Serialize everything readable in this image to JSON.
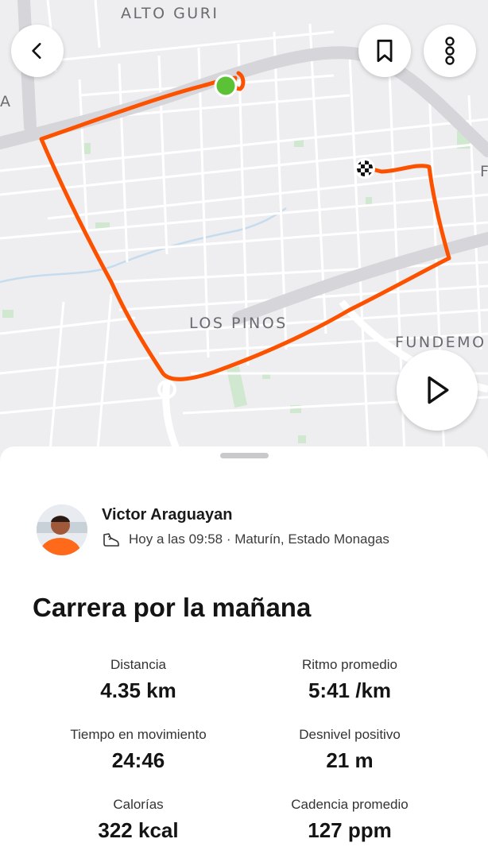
{
  "map": {
    "labels": [
      "ALTO GURI",
      "LOS PINOS",
      "FUNDEMO",
      "A",
      "F"
    ],
    "route_color": "#fc5200",
    "start_color": "#5bc236"
  },
  "controls": {
    "back_icon": "chevron-left-icon",
    "bookmark_icon": "bookmark-icon",
    "more_icon": "more-vertical-icon",
    "play_icon": "play-icon"
  },
  "activity": {
    "athlete_name": "Victor Araguayan",
    "meta_text": "Hoy a las 09:58 · Maturín, Estado Monagas",
    "title": "Carrera por la mañana"
  },
  "stats": [
    {
      "label": "Distancia",
      "value": "4.35 km"
    },
    {
      "label": "Ritmo promedio",
      "value": "5:41 /km"
    },
    {
      "label": "Tiempo en movimiento",
      "value": "24:46"
    },
    {
      "label": "Desnivel positivo",
      "value": "21 m"
    },
    {
      "label": "Calorías",
      "value": "322 kcal"
    },
    {
      "label": "Cadencia promedio",
      "value": "127 ppm"
    }
  ]
}
